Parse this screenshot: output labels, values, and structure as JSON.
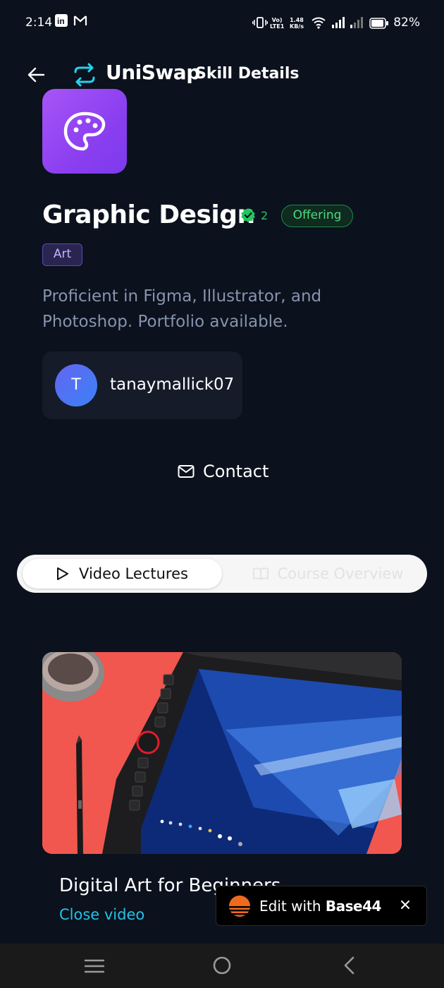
{
  "status_bar": {
    "time": "2:14",
    "network_speed_top": "1.48",
    "network_speed_bottom": "KB/s",
    "volte_top": "Vo)",
    "volte_bottom": "LTE1",
    "battery": "82%"
  },
  "header": {
    "brand": "UniSwap",
    "title": "Skill Details"
  },
  "skill": {
    "icon": "palette-icon",
    "title": "Graphic Design",
    "verified_count": "2",
    "status": "Offering",
    "category": "Art",
    "description": "Proficient in Figma, Illustrator, and Photoshop. Portfolio available."
  },
  "user": {
    "avatar_initial": "T",
    "username": "tanaymallick07"
  },
  "contact_label": "Contact",
  "tabs": [
    {
      "label": "Video Lectures",
      "icon": "play-icon",
      "active": true
    },
    {
      "label": "Course Overview",
      "icon": "book-icon",
      "active": false
    }
  ],
  "video": {
    "title": "Digital Art for Beginners",
    "close_label": "Close video"
  },
  "badge": {
    "prefix": "Edit with",
    "brand": "Base44"
  },
  "colors": {
    "background": "#0b111d",
    "accent_purple": "#8b3ff0",
    "offering_green": "#4ade80",
    "link_cyan": "#22c3e6"
  }
}
